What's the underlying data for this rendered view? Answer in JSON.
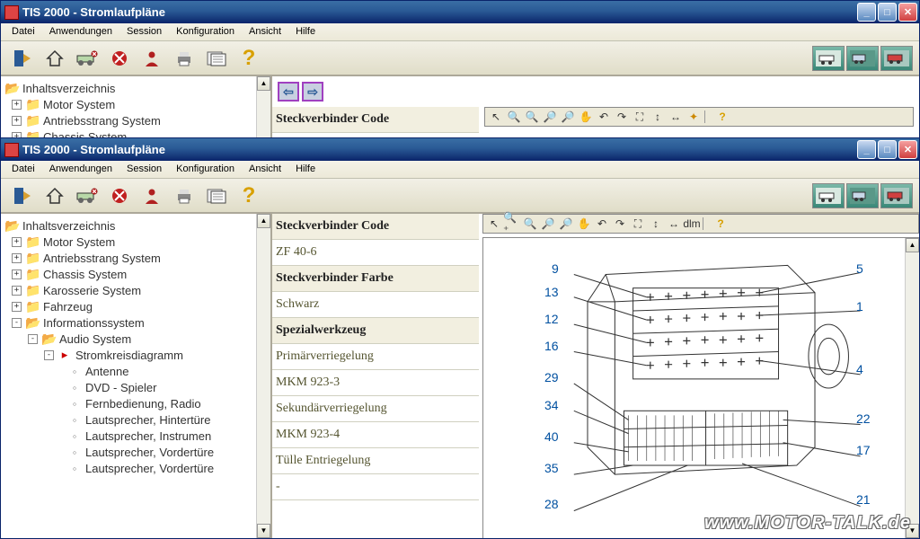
{
  "app_title": "TIS 2000 - Stromlaufpläne",
  "menubar": [
    "Datei",
    "Anwendungen",
    "Session",
    "Konfiguration",
    "Ansicht",
    "Hilfe"
  ],
  "sidebar": {
    "root": "Inhaltsverzeichnis",
    "top_items": [
      "Motor System",
      "Antriebsstrang System",
      "Chassis System"
    ],
    "full_items": [
      "Motor System",
      "Antriebsstrang System",
      "Chassis System",
      "Karosserie System",
      "Fahrzeug"
    ],
    "info_system": "Informationssystem",
    "audio_system": "Audio System",
    "stromkreis": "Stromkreisdiagramm",
    "leaves": [
      "Antenne",
      "DVD - Spieler",
      "Fernbedienung, Radio",
      "Lautsprecher, Hintertüre",
      "Lautsprecher, Instrumen",
      "Lautsprecher, Vordertüre",
      "Lautsprecher, Vordertüre"
    ]
  },
  "info": {
    "steckverbinder_code": "Steckverbinder Code",
    "zf": "ZF 40-6",
    "steckverbinder_farbe": "Steckverbinder Farbe",
    "schwarz": "Schwarz",
    "spezialwerkzeug": "Spezialwerkzeug",
    "primar": "Primärverriegelung",
    "mkm3": "MKM 923-3",
    "sekundar": "Sekundärverriegelung",
    "mkm4": "MKM 923-4",
    "tulle": "Tülle Entriegelung",
    "dash": "-"
  },
  "diagram_labels_left": [
    "9",
    "13",
    "12",
    "16",
    "29",
    "34",
    "40",
    "35",
    "28"
  ],
  "diagram_labels_right": [
    "5",
    "1",
    "4",
    "22",
    "17",
    "21"
  ],
  "watermark": "www.MOTOR-TALK.de"
}
